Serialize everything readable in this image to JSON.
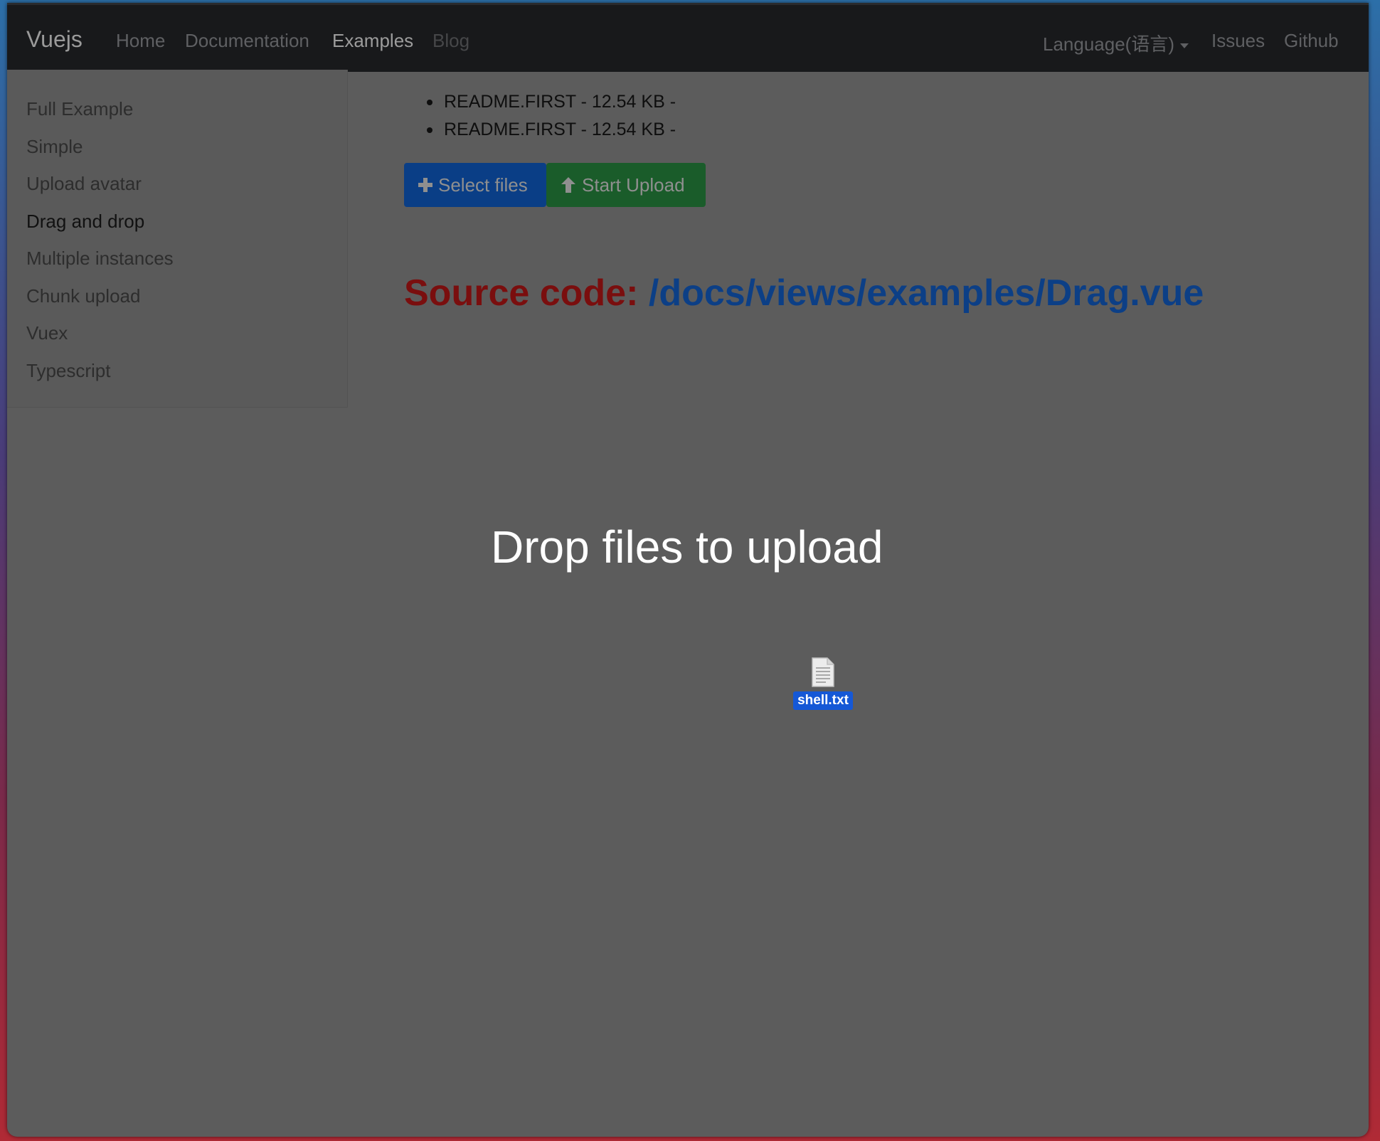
{
  "navbar": {
    "brand": "Vuejs",
    "links": [
      "Home",
      "Documentation",
      "Examples",
      "Blog"
    ],
    "right_links": [
      "Language(语言)",
      "Issues",
      "Github"
    ]
  },
  "sidebar": {
    "items": [
      "Full Example",
      "Simple",
      "Upload avatar",
      "Drag and drop",
      "Multiple instances",
      "Chunk upload",
      "Vuex",
      "Typescript"
    ],
    "active": "Drag and drop"
  },
  "files": [
    "README.FIRST - 12.54 KB -",
    "README.FIRST - 12.54 KB -"
  ],
  "buttons": {
    "select": "Select files",
    "upload": "Start Upload"
  },
  "source": {
    "label": "Source code:",
    "path": "/docs/views/examples/Drag.vue"
  },
  "overlay": {
    "message": "Drop files to upload",
    "dragged_file": "shell.txt"
  }
}
